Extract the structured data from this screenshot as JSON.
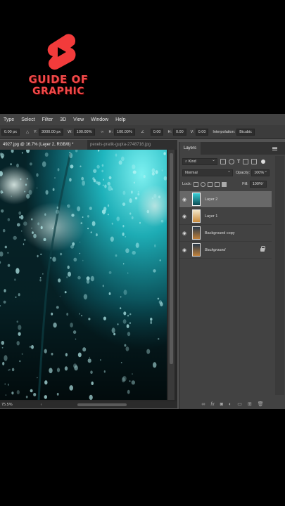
{
  "logo": {
    "line1": "GUIDE OF",
    "line2": "GRAPHIC"
  },
  "menu": [
    "Type",
    "Select",
    "Filter",
    "3D",
    "View",
    "Window",
    "Help"
  ],
  "options": {
    "x_val": "0.00 px",
    "y_label": "Y:",
    "y_val": "3000.00 px",
    "w_label": "W:",
    "w_val": "100.00%",
    "h_label": "H:",
    "h_val": "100.00%",
    "angle_val": "0.00",
    "hskew_label": "H:",
    "hskew_val": "0.00",
    "vskew_label": "V:",
    "vskew_val": "0.00",
    "interp_label": "Interpolation:",
    "interp_val": "Bicubic"
  },
  "tabs": {
    "active": "4927.jpg @ 16.7% (Layer 2, RGB/8) *",
    "inactive": "pexels-pratik-gupta-2748716.jpg"
  },
  "status": "75.5%",
  "layers_panel": {
    "tab_label": "Layers",
    "kind_label": "Kind",
    "blend_mode": "Normal",
    "opacity_label": "Opacity:",
    "opacity_val": "100%",
    "lock_label": "Lock:",
    "fill_label": "Fill:",
    "fill_val": "100%",
    "layers": [
      {
        "name": "Layer 2",
        "selected": true,
        "italic": false,
        "locked": false
      },
      {
        "name": "Layer 1",
        "selected": false,
        "italic": false,
        "locked": false
      },
      {
        "name": "Background copy",
        "selected": false,
        "italic": false,
        "locked": false
      },
      {
        "name": "Background",
        "selected": false,
        "italic": true,
        "locked": true
      }
    ],
    "footer_icons": [
      "link-icon",
      "fx-icon",
      "mask-icon",
      "adjustment-icon",
      "group-icon",
      "new-layer-icon",
      "trash-icon"
    ]
  },
  "colors": {
    "accent_red": "#f04a4a",
    "ps_bg": "#535353",
    "panel_bg": "#424242"
  }
}
